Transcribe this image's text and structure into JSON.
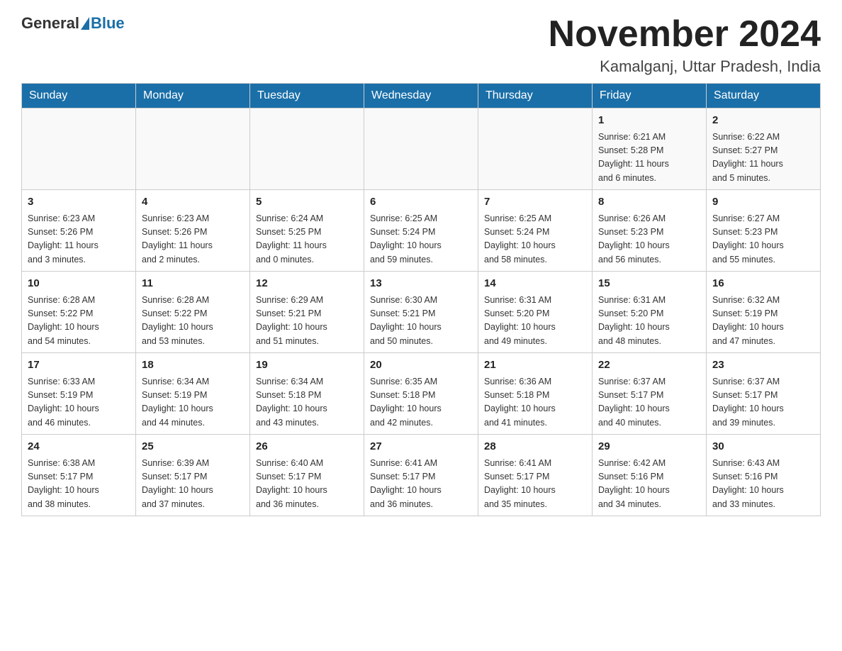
{
  "logo": {
    "general": "General",
    "blue": "Blue"
  },
  "title": "November 2024",
  "subtitle": "Kamalganj, Uttar Pradesh, India",
  "days_of_week": [
    "Sunday",
    "Monday",
    "Tuesday",
    "Wednesday",
    "Thursday",
    "Friday",
    "Saturday"
  ],
  "weeks": [
    [
      {
        "day": "",
        "info": ""
      },
      {
        "day": "",
        "info": ""
      },
      {
        "day": "",
        "info": ""
      },
      {
        "day": "",
        "info": ""
      },
      {
        "day": "",
        "info": ""
      },
      {
        "day": "1",
        "info": "Sunrise: 6:21 AM\nSunset: 5:28 PM\nDaylight: 11 hours\nand 6 minutes."
      },
      {
        "day": "2",
        "info": "Sunrise: 6:22 AM\nSunset: 5:27 PM\nDaylight: 11 hours\nand 5 minutes."
      }
    ],
    [
      {
        "day": "3",
        "info": "Sunrise: 6:23 AM\nSunset: 5:26 PM\nDaylight: 11 hours\nand 3 minutes."
      },
      {
        "day": "4",
        "info": "Sunrise: 6:23 AM\nSunset: 5:26 PM\nDaylight: 11 hours\nand 2 minutes."
      },
      {
        "day": "5",
        "info": "Sunrise: 6:24 AM\nSunset: 5:25 PM\nDaylight: 11 hours\nand 0 minutes."
      },
      {
        "day": "6",
        "info": "Sunrise: 6:25 AM\nSunset: 5:24 PM\nDaylight: 10 hours\nand 59 minutes."
      },
      {
        "day": "7",
        "info": "Sunrise: 6:25 AM\nSunset: 5:24 PM\nDaylight: 10 hours\nand 58 minutes."
      },
      {
        "day": "8",
        "info": "Sunrise: 6:26 AM\nSunset: 5:23 PM\nDaylight: 10 hours\nand 56 minutes."
      },
      {
        "day": "9",
        "info": "Sunrise: 6:27 AM\nSunset: 5:23 PM\nDaylight: 10 hours\nand 55 minutes."
      }
    ],
    [
      {
        "day": "10",
        "info": "Sunrise: 6:28 AM\nSunset: 5:22 PM\nDaylight: 10 hours\nand 54 minutes."
      },
      {
        "day": "11",
        "info": "Sunrise: 6:28 AM\nSunset: 5:22 PM\nDaylight: 10 hours\nand 53 minutes."
      },
      {
        "day": "12",
        "info": "Sunrise: 6:29 AM\nSunset: 5:21 PM\nDaylight: 10 hours\nand 51 minutes."
      },
      {
        "day": "13",
        "info": "Sunrise: 6:30 AM\nSunset: 5:21 PM\nDaylight: 10 hours\nand 50 minutes."
      },
      {
        "day": "14",
        "info": "Sunrise: 6:31 AM\nSunset: 5:20 PM\nDaylight: 10 hours\nand 49 minutes."
      },
      {
        "day": "15",
        "info": "Sunrise: 6:31 AM\nSunset: 5:20 PM\nDaylight: 10 hours\nand 48 minutes."
      },
      {
        "day": "16",
        "info": "Sunrise: 6:32 AM\nSunset: 5:19 PM\nDaylight: 10 hours\nand 47 minutes."
      }
    ],
    [
      {
        "day": "17",
        "info": "Sunrise: 6:33 AM\nSunset: 5:19 PM\nDaylight: 10 hours\nand 46 minutes."
      },
      {
        "day": "18",
        "info": "Sunrise: 6:34 AM\nSunset: 5:19 PM\nDaylight: 10 hours\nand 44 minutes."
      },
      {
        "day": "19",
        "info": "Sunrise: 6:34 AM\nSunset: 5:18 PM\nDaylight: 10 hours\nand 43 minutes."
      },
      {
        "day": "20",
        "info": "Sunrise: 6:35 AM\nSunset: 5:18 PM\nDaylight: 10 hours\nand 42 minutes."
      },
      {
        "day": "21",
        "info": "Sunrise: 6:36 AM\nSunset: 5:18 PM\nDaylight: 10 hours\nand 41 minutes."
      },
      {
        "day": "22",
        "info": "Sunrise: 6:37 AM\nSunset: 5:17 PM\nDaylight: 10 hours\nand 40 minutes."
      },
      {
        "day": "23",
        "info": "Sunrise: 6:37 AM\nSunset: 5:17 PM\nDaylight: 10 hours\nand 39 minutes."
      }
    ],
    [
      {
        "day": "24",
        "info": "Sunrise: 6:38 AM\nSunset: 5:17 PM\nDaylight: 10 hours\nand 38 minutes."
      },
      {
        "day": "25",
        "info": "Sunrise: 6:39 AM\nSunset: 5:17 PM\nDaylight: 10 hours\nand 37 minutes."
      },
      {
        "day": "26",
        "info": "Sunrise: 6:40 AM\nSunset: 5:17 PM\nDaylight: 10 hours\nand 36 minutes."
      },
      {
        "day": "27",
        "info": "Sunrise: 6:41 AM\nSunset: 5:17 PM\nDaylight: 10 hours\nand 36 minutes."
      },
      {
        "day": "28",
        "info": "Sunrise: 6:41 AM\nSunset: 5:17 PM\nDaylight: 10 hours\nand 35 minutes."
      },
      {
        "day": "29",
        "info": "Sunrise: 6:42 AM\nSunset: 5:16 PM\nDaylight: 10 hours\nand 34 minutes."
      },
      {
        "day": "30",
        "info": "Sunrise: 6:43 AM\nSunset: 5:16 PM\nDaylight: 10 hours\nand 33 minutes."
      }
    ]
  ]
}
